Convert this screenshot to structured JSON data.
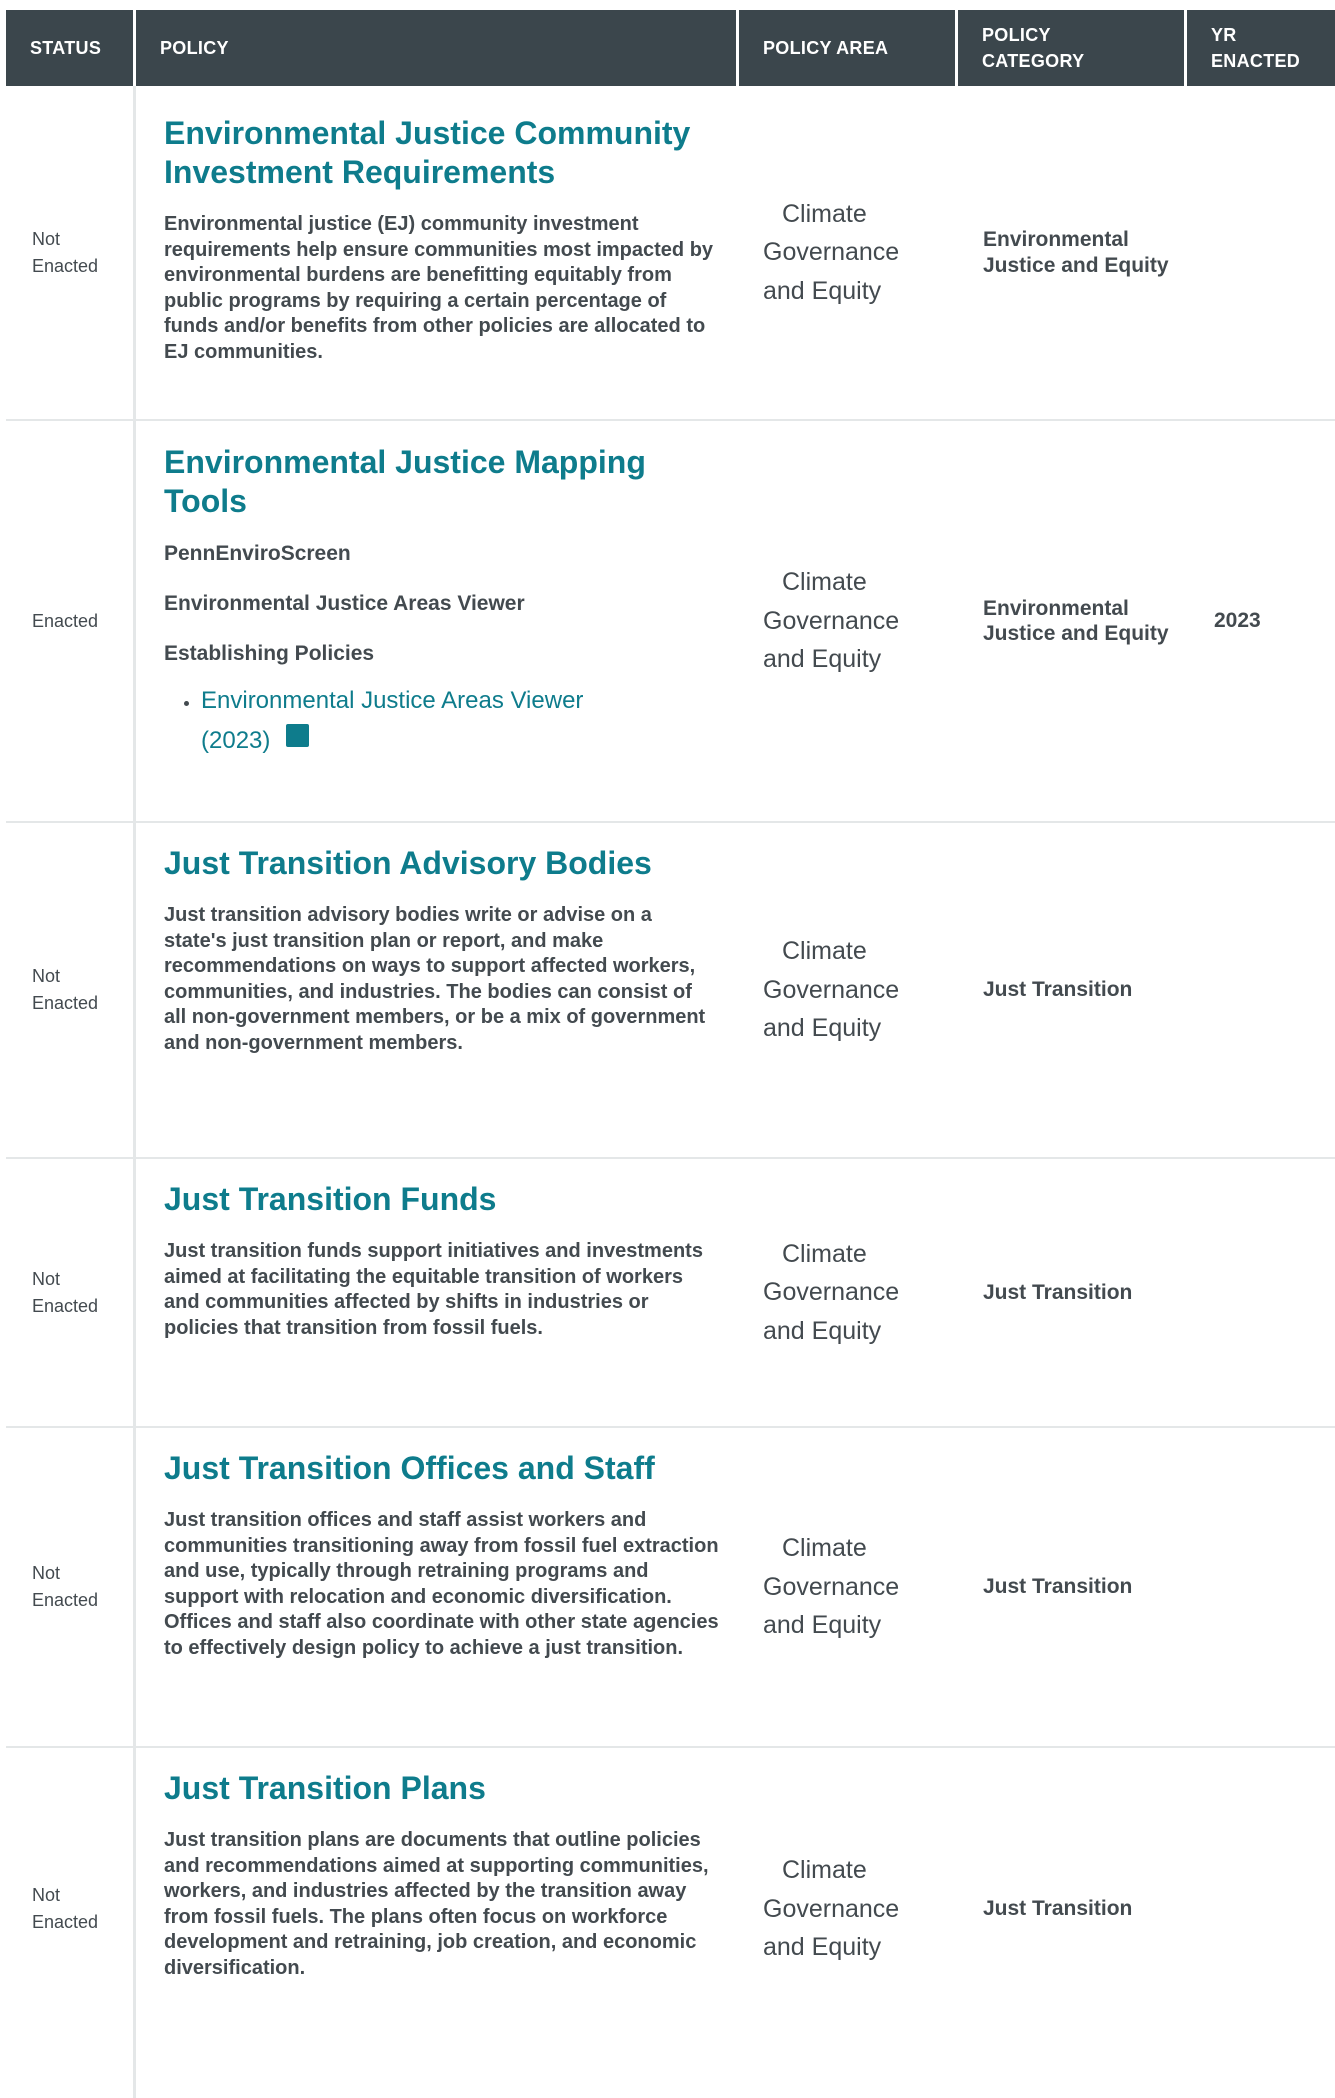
{
  "headers": {
    "status": "STATUS",
    "policy": "POLICY",
    "policy_area": "POLICY AREA",
    "policy_category_1": "POLICY",
    "policy_category_2": "CATEGORY",
    "yr_1": "YR",
    "yr_2": "ENACTED"
  },
  "rows": [
    {
      "status_1": "Not",
      "status_2": "Enacted",
      "title_1": "Environmental Justice Community",
      "title_2": "Investment Requirements",
      "description": "Environmental justice (EJ) community investment requirements help ensure communities most impacted by environmental burdens are benefitting equitably from public programs by requiring a certain percentage of funds and/or benefits from other policies are allocated to EJ communities.",
      "area_1": "Climate",
      "area_2": "Governance",
      "area_3": "and Equity",
      "category": "Environmental Justice and Equity",
      "year": ""
    },
    {
      "status_1": "Enacted",
      "status_2": "",
      "title_1": "Environmental Justice Mapping",
      "title_2": "Tools",
      "sub_1": "PennEnviroScreen",
      "sub_2": "Environmental Justice Areas Viewer",
      "sub_3": "Establishing Policies",
      "doc_link_1": "Environmental Justice Areas Viewer",
      "doc_link_2": "(2023)",
      "doc_icon": "document-icon",
      "area_1": "Climate",
      "area_2": "Governance",
      "area_3": "and Equity",
      "category": "Environmental Justice and Equity",
      "year": "2023"
    },
    {
      "status_1": "Not",
      "status_2": "Enacted",
      "title_1": "Just Transition Advisory Bodies",
      "description": "Just transition advisory bodies write or advise on a state's just transition plan or report, and make recommendations on ways to support affected workers, communities, and industries. The bodies can consist of all non-government members, or be a mix of government and non-government members.",
      "area_1": "Climate",
      "area_2": "Governance",
      "area_3": "and Equity",
      "category": "Just Transition",
      "year": ""
    },
    {
      "status_1": "Not",
      "status_2": "Enacted",
      "title_1": "Just Transition Funds",
      "description": "Just transition funds support initiatives and investments aimed at facilitating the equitable transition of workers and communities affected by shifts in industries or policies that transition from fossil fuels.",
      "area_1": "Climate",
      "area_2": "Governance",
      "area_3": "and Equity",
      "category": "Just Transition",
      "year": ""
    },
    {
      "status_1": "Not",
      "status_2": "Enacted",
      "title_1": "Just Transition Offices and Staff",
      "description": "Just transition offices and staff assist workers and communities transitioning away from fossil fuel extraction and use, typically through retraining programs and support with relocation and economic diversification. Offices and staff also coordinate with other state agencies to effectively design policy to achieve a just transition.",
      "area_1": "Climate",
      "area_2": "Governance",
      "area_3": "and Equity",
      "category": "Just Transition",
      "year": ""
    },
    {
      "status_1": "Not",
      "status_2": "Enacted",
      "title_1": "Just Transition Plans",
      "description": "Just transition plans are documents that outline policies and recommendations aimed at supporting communities, workers, and industries affected by the transition away from fossil fuels. The plans often focus on workforce development and retraining, job creation, and economic diversification.",
      "area_1": "Climate",
      "area_2": "Governance",
      "area_3": "and Equity",
      "category": "Just Transition",
      "year": ""
    }
  ],
  "colors": {
    "header_bg": "#3b464c",
    "link": "#0e7c8c",
    "text": "#434a4f",
    "divider": "#e4e7e8"
  }
}
